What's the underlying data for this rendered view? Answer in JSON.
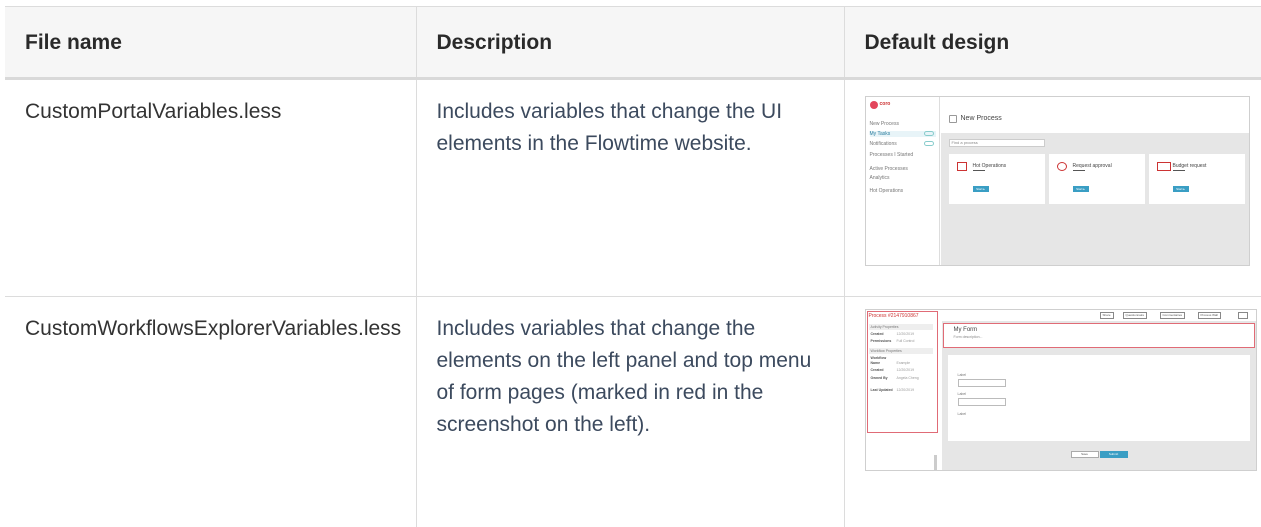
{
  "table": {
    "headers": [
      "File name",
      "Description",
      "Default design"
    ],
    "rows": [
      {
        "file_name": "CustomPortalVariables.less",
        "description": "Includes variables that change the UI elements in the Flowtime website.",
        "thumbnail": {
          "logo_text": "coro",
          "nav_items": [
            "New Process",
            "My Tasks",
            "Notifications",
            "Processes I Started",
            "Active Processes",
            "Analytics",
            "Hot Operations"
          ],
          "page_title": "New Process",
          "search_placeholder": "Find a process",
          "cards": [
            {
              "name": "Hot Operations",
              "button": "Start ▸"
            },
            {
              "name": "Request approval",
              "button": "Start ▸"
            },
            {
              "name": "Budget request",
              "button": "Start ▸"
            }
          ]
        }
      },
      {
        "file_name": "CustomWorkflowsExplorerVariables.less",
        "description": "Includes variables that change the elements on the left panel and top menu of form pages (marked in red in the screenshot on the left).",
        "thumbnail": {
          "process_title": "Process #2147910867",
          "activity_section": "Activity Properties",
          "activity_rows": [
            {
              "k": "Created",
              "v": "12/20/2019"
            },
            {
              "k": "Permissions",
              "v": "Full Control"
            }
          ],
          "workflow_section": "Workflow Properties",
          "workflow_rows": [
            {
              "k": "Workflow Name",
              "v": "Example"
            },
            {
              "k": "Created",
              "v": "12/20/2019"
            },
            {
              "k": "Owned By",
              "v": "Angela Cheng"
            },
            {
              "k": "Last Updated",
              "v": "12/20/2019"
            }
          ],
          "toolbar": [
            "Share",
            "Questionnaire",
            "Commentaries",
            "Process Wall"
          ],
          "form_title": "My Form",
          "form_description": "Form description...",
          "field_labels": [
            "Label",
            "Label",
            "Label"
          ],
          "save_label": "Save",
          "submit_label": "Submit"
        }
      }
    ]
  },
  "colors": {
    "link_text": "#3c4a5e",
    "accent": "#3a9ec4",
    "highlight_red": "#e06b76"
  }
}
